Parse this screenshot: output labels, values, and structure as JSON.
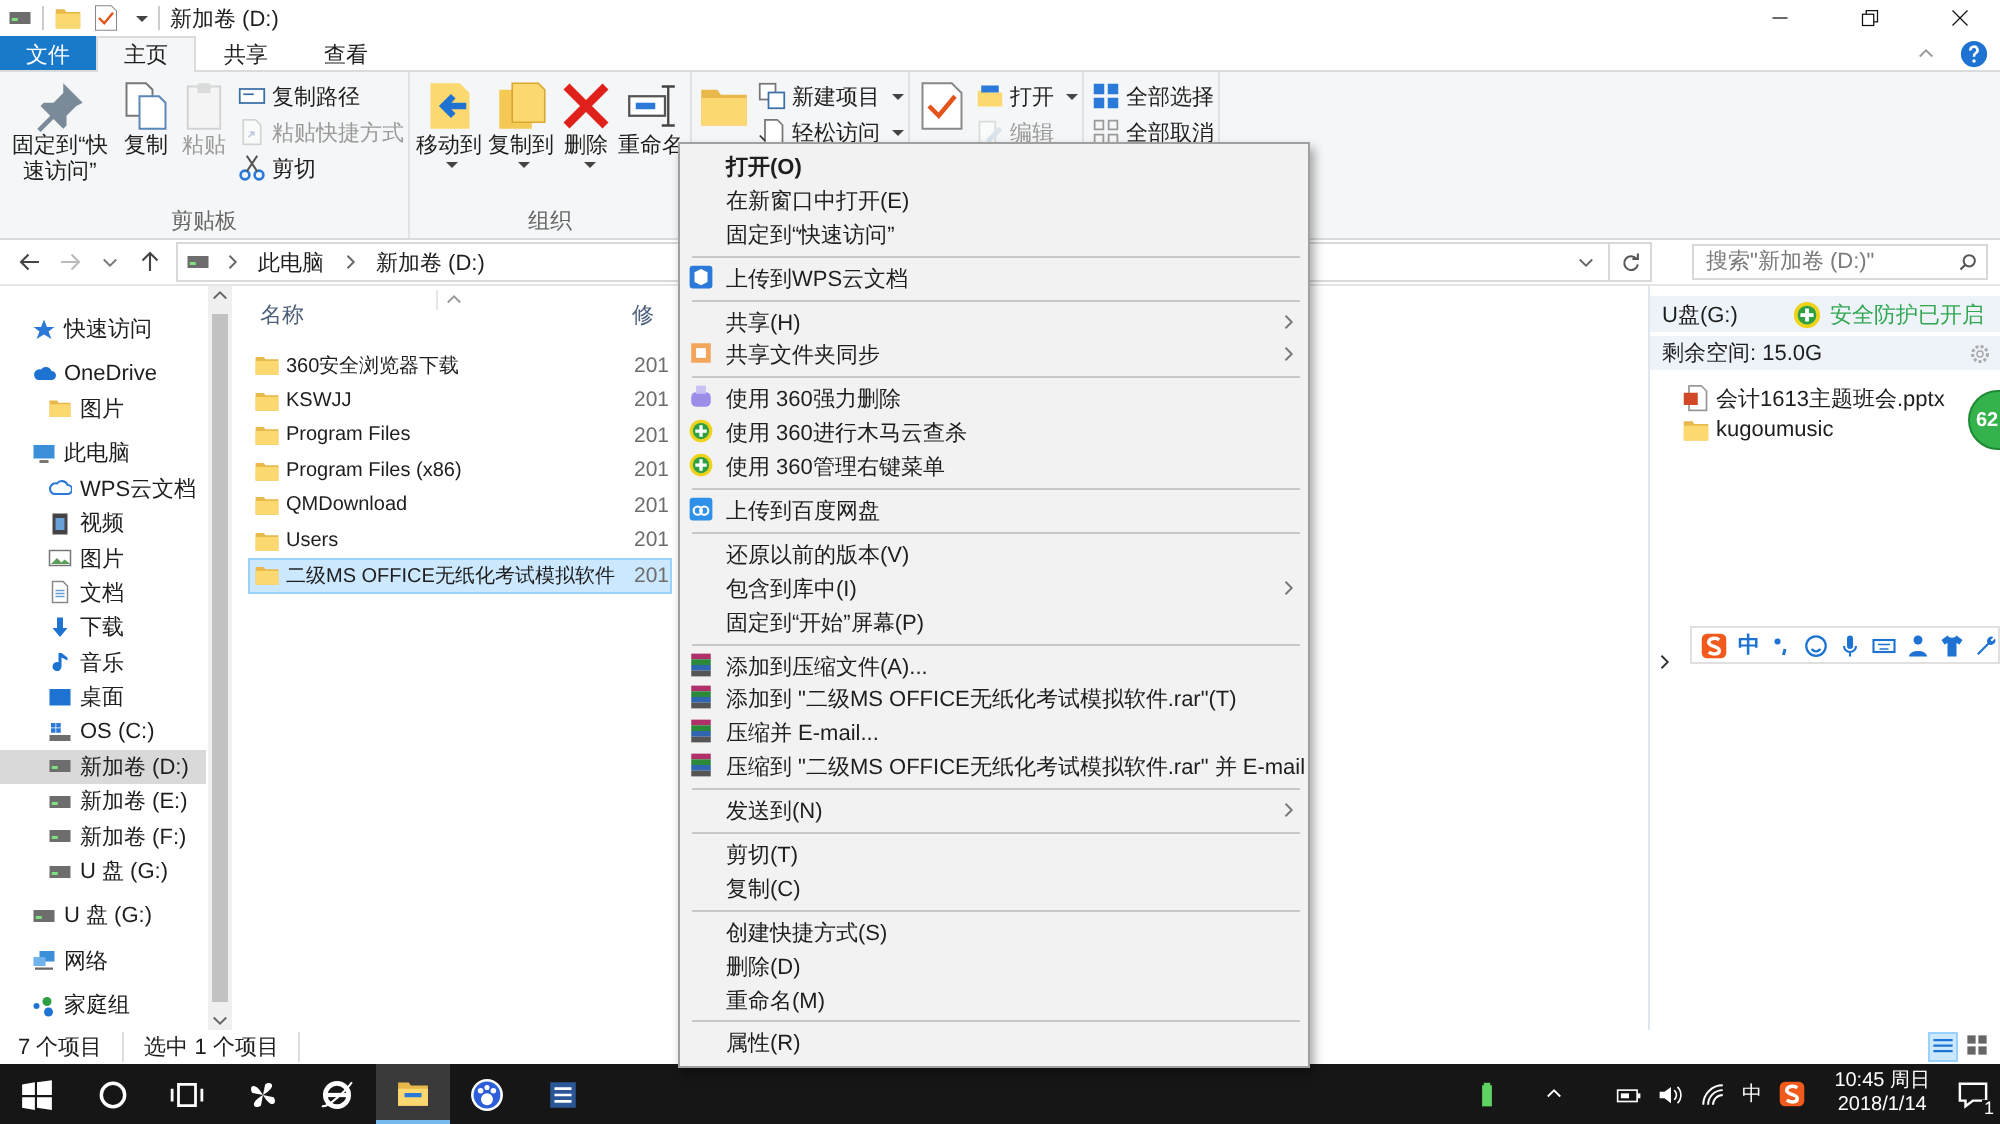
{
  "window": {
    "title": "新加卷 (D:)"
  },
  "tabs": [
    {
      "label": "文件",
      "kind": "file",
      "selected": false
    },
    {
      "label": "主页",
      "kind": "tab",
      "selected": true
    },
    {
      "label": "共享",
      "kind": "tab",
      "selected": false
    },
    {
      "label": "查看",
      "kind": "tab",
      "selected": false
    }
  ],
  "ribbon": {
    "groups": [
      {
        "label": "剪贴板",
        "large": [
          {
            "label": "固定到“快速访问”",
            "kind": "pin",
            "disabled": false,
            "dropdown": false
          },
          {
            "label": "复制",
            "kind": "copy",
            "disabled": false,
            "dropdown": false
          },
          {
            "label": "粘贴",
            "kind": "paste",
            "disabled": true,
            "dropdown": false
          }
        ],
        "small": [
          {
            "label": "复制路径",
            "kind": "copypath",
            "disabled": false,
            "dropdown": false
          },
          {
            "label": "粘贴快捷方式",
            "kind": "pasteshortcut",
            "disabled": true,
            "dropdown": false
          },
          {
            "label": "剪切",
            "kind": "cut",
            "disabled": false,
            "dropdown": false
          }
        ]
      },
      {
        "label": "组织",
        "large": [
          {
            "label": "移动到",
            "kind": "moveto",
            "disabled": false,
            "dropdown": true
          },
          {
            "label": "复制到",
            "kind": "copyto",
            "disabled": false,
            "dropdown": true
          },
          {
            "label": "删除",
            "kind": "delete",
            "disabled": false,
            "dropdown": true
          },
          {
            "label": "重命名",
            "kind": "rename",
            "disabled": false,
            "dropdown": false
          }
        ]
      },
      {
        "large": [
          {
            "kind": "folder",
            "disabled": false,
            "dropdown": false
          }
        ],
        "small": [
          {
            "label": "新建项目",
            "kind": "newitem",
            "disabled": false,
            "dropdown": true
          },
          {
            "label": "轻松访问",
            "kind": "easyaccess",
            "disabled": false,
            "dropdown": true
          }
        ]
      },
      {
        "large": [
          {
            "kind": "properties",
            "disabled": false,
            "dropdown": false
          }
        ],
        "small": [
          {
            "label": "打开",
            "kind": "open",
            "disabled": false,
            "dropdown": true
          },
          {
            "label": "编辑",
            "kind": "edit",
            "disabled": true,
            "dropdown": false
          }
        ]
      },
      {
        "small": [
          {
            "label": "全部选择",
            "kind": "selectall",
            "disabled": false,
            "dropdown": false
          },
          {
            "label": "全部取消",
            "kind": "selectnone",
            "disabled": false,
            "dropdown": false
          }
        ]
      }
    ]
  },
  "address": {
    "crumbs": [
      "此电脑",
      "新加卷 (D:)"
    ],
    "search_placeholder": "搜索\"新加卷 (D:)\""
  },
  "nav": [
    {
      "label": "快速访问",
      "kind": "star",
      "selected": false
    },
    {
      "label": "OneDrive",
      "kind": "cloud",
      "selected": false,
      "children": [
        {
          "label": "图片",
          "kind": "folder",
          "selected": false
        }
      ]
    },
    {
      "label": "此电脑",
      "kind": "pc",
      "selected": false,
      "children": [
        {
          "label": "WPS云文档",
          "kind": "wpscloud",
          "selected": false
        },
        {
          "label": "视频",
          "kind": "video",
          "selected": false
        },
        {
          "label": "图片",
          "kind": "picture",
          "selected": false
        },
        {
          "label": "文档",
          "kind": "doc",
          "selected": false
        },
        {
          "label": "下载",
          "kind": "download",
          "selected": false
        },
        {
          "label": "音乐",
          "kind": "music",
          "selected": false
        },
        {
          "label": "桌面",
          "kind": "desktop",
          "selected": false
        },
        {
          "label": "OS (C:)",
          "kind": "osdrive",
          "selected": false
        },
        {
          "label": "新加卷 (D:)",
          "kind": "drive",
          "selected": true
        },
        {
          "label": "新加卷 (E:)",
          "kind": "drive",
          "selected": false
        },
        {
          "label": "新加卷 (F:)",
          "kind": "drive",
          "selected": false
        },
        {
          "label": "U 盘 (G:)",
          "kind": "drive",
          "selected": false
        }
      ]
    },
    {
      "label": "U 盘 (G:)",
      "kind": "drive",
      "selected": false
    },
    {
      "label": "网络",
      "kind": "network",
      "selected": false
    },
    {
      "label": "家庭组",
      "kind": "homegroup",
      "selected": false
    }
  ],
  "files": {
    "columns": [
      "名称",
      "修"
    ],
    "rows": [
      {
        "name": "360安全浏览器下载",
        "date": "201",
        "selected": false
      },
      {
        "name": "KSWJJ",
        "date": "201",
        "selected": false
      },
      {
        "name": "Program Files",
        "date": "201",
        "selected": false
      },
      {
        "name": "Program Files (x86)",
        "date": "201",
        "selected": false
      },
      {
        "name": "QMDownload",
        "date": "201",
        "selected": false
      },
      {
        "name": "Users",
        "date": "201",
        "selected": false
      },
      {
        "name": "二级MS OFFICE无纸化考试模拟软件",
        "date": "201",
        "selected": true
      }
    ]
  },
  "usb_panel": {
    "drive": "U盘(G:)",
    "protection": "安全防护已开启",
    "free_space": "剩余空间: 15.0G",
    "files": [
      {
        "name": "会计1613主题班会.pptx",
        "kind": "pptx"
      },
      {
        "name": "kugoumusic",
        "kind": "folder"
      }
    ],
    "badge": "62",
    "input_mode": "中"
  },
  "context_menu": [
    {
      "kind": "plain",
      "label": "打开(O)",
      "default": true,
      "submenu": false
    },
    {
      "kind": "plain",
      "label": "在新窗口中打开(E)",
      "default": false,
      "submenu": false
    },
    {
      "kind": "plain",
      "label": "固定到“快速访问”",
      "default": false,
      "submenu": false
    },
    {
      "kind": "separator"
    },
    {
      "kind": "wps",
      "label": "上传到WPS云文档",
      "default": false,
      "submenu": false
    },
    {
      "kind": "separator"
    },
    {
      "kind": "plain",
      "label": "共享(H)",
      "default": false,
      "submenu": true
    },
    {
      "kind": "sync",
      "label": "共享文件夹同步",
      "default": false,
      "submenu": true
    },
    {
      "kind": "separator"
    },
    {
      "kind": "del360",
      "label": "使用 360强力删除",
      "default": false,
      "submenu": false
    },
    {
      "kind": "green360",
      "label": "使用 360进行木马云查杀",
      "default": false,
      "submenu": false
    },
    {
      "kind": "green360",
      "label": "使用 360管理右键菜单",
      "default": false,
      "submenu": false
    },
    {
      "kind": "separator"
    },
    {
      "kind": "baidu",
      "label": "上传到百度网盘",
      "default": false,
      "submenu": false
    },
    {
      "kind": "separator"
    },
    {
      "kind": "plain",
      "label": "还原以前的版本(V)",
      "default": false,
      "submenu": false
    },
    {
      "kind": "plain",
      "label": "包含到库中(I)",
      "default": false,
      "submenu": true
    },
    {
      "kind": "plain",
      "label": "固定到“开始”屏幕(P)",
      "default": false,
      "submenu": false
    },
    {
      "kind": "separator"
    },
    {
      "kind": "rar",
      "label": "添加到压缩文件(A)...",
      "default": false,
      "submenu": false
    },
    {
      "kind": "rar",
      "label": "添加到 \"二级MS OFFICE无纸化考试模拟软件.rar\"(T)",
      "default": false,
      "submenu": false
    },
    {
      "kind": "rar",
      "label": "压缩并 E-mail...",
      "default": false,
      "submenu": false
    },
    {
      "kind": "rar",
      "label": "压缩到 \"二级MS OFFICE无纸化考试模拟软件.rar\" 并 E-mail",
      "default": false,
      "submenu": false
    },
    {
      "kind": "separator"
    },
    {
      "kind": "plain",
      "label": "发送到(N)",
      "default": false,
      "submenu": true
    },
    {
      "kind": "separator"
    },
    {
      "kind": "plain",
      "label": "剪切(T)",
      "default": false,
      "submenu": false
    },
    {
      "kind": "plain",
      "label": "复制(C)",
      "default": false,
      "submenu": false
    },
    {
      "kind": "separator"
    },
    {
      "kind": "plain",
      "label": "创建快捷方式(S)",
      "default": false,
      "submenu": false
    },
    {
      "kind": "plain",
      "label": "删除(D)",
      "default": false,
      "submenu": false
    },
    {
      "kind": "plain",
      "label": "重命名(M)",
      "default": false,
      "submenu": false
    },
    {
      "kind": "separator"
    },
    {
      "kind": "plain",
      "label": "属性(R)",
      "default": false,
      "submenu": false
    }
  ],
  "status_bar": {
    "count": "7 个项目",
    "selection": "选中 1 个项目"
  },
  "taskbar": {
    "apps": [
      {
        "kind": "start",
        "active": false
      },
      {
        "kind": "search",
        "active": false
      },
      {
        "kind": "taskview",
        "active": false
      },
      {
        "kind": "pinwheel",
        "active": false
      },
      {
        "kind": "ie",
        "active": false
      },
      {
        "kind": "explorer",
        "active": true
      },
      {
        "kind": "baidu",
        "active": false
      },
      {
        "kind": "word",
        "active": false
      }
    ],
    "ime": "中",
    "time": "10:45 周日",
    "date": "2018/1/14",
    "notifications": "1"
  }
}
